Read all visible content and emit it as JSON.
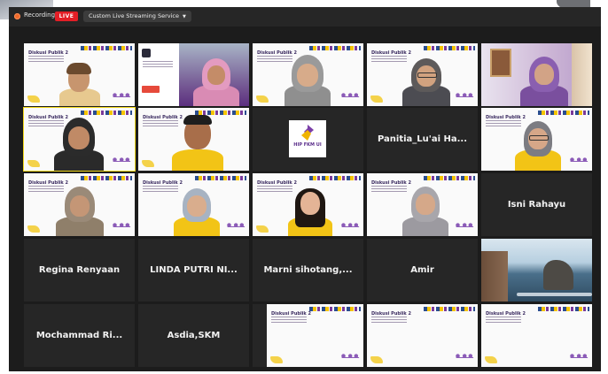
{
  "topbar": {
    "recording_label": "Recording",
    "live_badge": "LIVE",
    "service_label": "Custom Live Streaming Service",
    "service_caret_icon": "chevron-down-icon"
  },
  "slide": {
    "title": "Diskusi Publik 2"
  },
  "logo_tile": {
    "text": "HIP FKM UI"
  },
  "participants": [
    {
      "name": "Panitia_Lu'ai Ha..."
    },
    {
      "name": "Isni Rahayu"
    },
    {
      "name": "Regina Renyaan"
    },
    {
      "name": "LINDA PUTRI NI..."
    },
    {
      "name": "Marni sihotang,..."
    },
    {
      "name": "Amir"
    },
    {
      "name": "Mochammad Ri..."
    },
    {
      "name": "Asdia,SKM"
    }
  ],
  "colors": {
    "live_red": "#e31e26",
    "highlight_yellow": "#f2d91a",
    "tile_bg": "#262626",
    "frame_bg": "#1c1c1c"
  }
}
